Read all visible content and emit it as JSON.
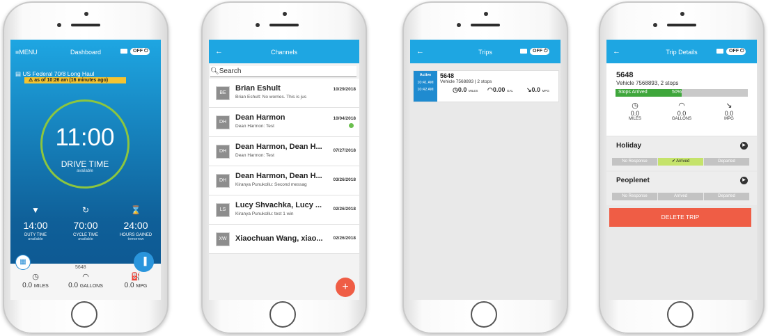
{
  "phones": {
    "dashboard": {
      "menu_label": "≡MENU",
      "title": "Dashboard",
      "status_toggle": "OFF",
      "ruleset": "US Federal 70/8 Long Haul",
      "alert": "as of 10:26 am (16 minutes ago)",
      "drive_time": "11:00",
      "drive_label": "DRIVE TIME",
      "drive_sub": "available",
      "stats": [
        {
          "value": "14:00",
          "name": "DUTY TIME",
          "sub": "available"
        },
        {
          "value": "70:00",
          "name": "CYCLE TIME",
          "sub": "available"
        },
        {
          "value": "24:00",
          "name": "HOURS GAINED",
          "sub": "tomorrow"
        }
      ],
      "vehicle_id": "5648",
      "footer": [
        {
          "value": "0.0",
          "unit": "MILES"
        },
        {
          "value": "0.0",
          "unit": "GALLONS"
        },
        {
          "value": "0.0",
          "unit": "MPG"
        }
      ]
    },
    "channels": {
      "title": "Channels",
      "search_placeholder": "Search",
      "rows": [
        {
          "initials": "BE",
          "name": "Brian Eshult",
          "preview": "Brian Eshult: No worries. This is jus",
          "date": "10/29/2018",
          "unread": false
        },
        {
          "initials": "DH",
          "name": "Dean Harmon",
          "preview": "Dean Harmon: Test",
          "date": "10/04/2018",
          "unread": true
        },
        {
          "initials": "DH",
          "name": "Dean Harmon, Dean H...",
          "preview": "Dean Harmon: Test",
          "date": "07/27/2018",
          "unread": false
        },
        {
          "initials": "DH",
          "name": "Dean Harmon, Dean H...",
          "preview": "Kiranya Punukollu: Second messag",
          "date": "03/26/2018",
          "unread": false
        },
        {
          "initials": "LS",
          "name": "Lucy Shvachka, Lucy ...",
          "preview": "Kiranya Punukollu: test 1 win",
          "date": "02/26/2018",
          "unread": false
        },
        {
          "initials": "XW",
          "name": "Xiaochuan Wang, xiao...",
          "preview": "",
          "date": "02/26/2018",
          "unread": false
        }
      ],
      "fab": "+"
    },
    "trips": {
      "title": "Trips",
      "status_toggle": "OFF",
      "trip": {
        "status": "Active",
        "start": "10:41 AM",
        "end": "10:42 AM",
        "number": "5648",
        "vehicle": "Vehicle 7568893 | 2 stops",
        "metrics": [
          {
            "value": "0.0",
            "unit": "MILES"
          },
          {
            "value": "0.00",
            "unit": "GAL"
          },
          {
            "value": "0.0",
            "unit": "MPG"
          }
        ]
      }
    },
    "trip_details": {
      "title": "Trip Details",
      "status_toggle": "OFF",
      "number": "5648",
      "vehicle": "Vehicle 7568893, 2 stops",
      "progress_label": "Stops Arrived",
      "progress_text": "50%",
      "progress_fraction": 0.5,
      "metrics": [
        {
          "value": "0.0",
          "unit": "MILES"
        },
        {
          "value": "0.0",
          "unit": "GALLONS"
        },
        {
          "value": "0.0",
          "unit": "MPG"
        }
      ],
      "stops": [
        {
          "name": "Holiday",
          "states": [
            "No Response",
            "✔ Arrived",
            "Departed"
          ],
          "active": 1
        },
        {
          "name": "Peoplenet",
          "states": [
            "No Response",
            "Arrived",
            "Departed"
          ],
          "active": -1
        }
      ],
      "delete_label": "DELETE TRIP"
    }
  }
}
